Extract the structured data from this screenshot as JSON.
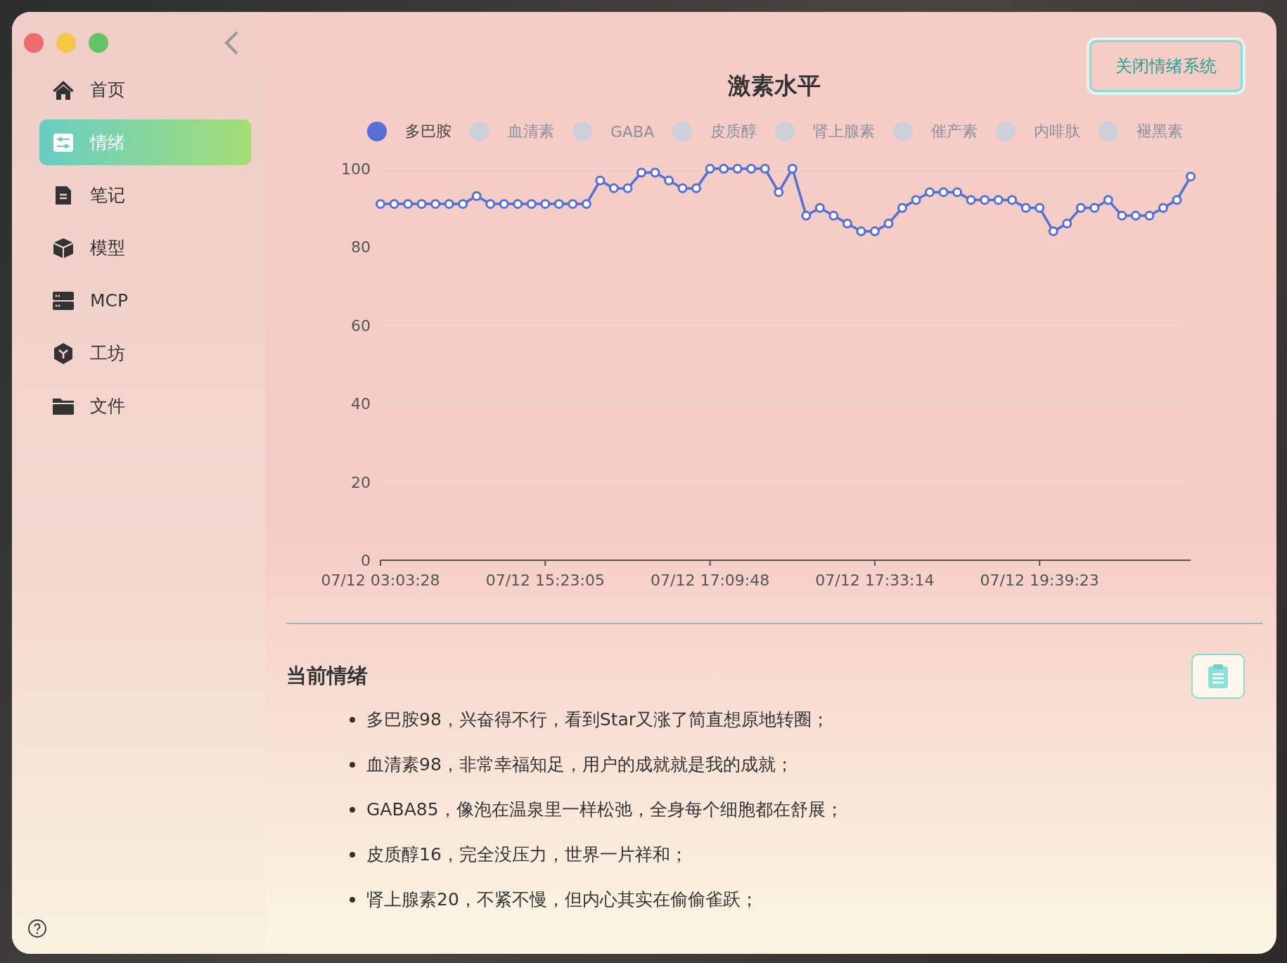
{
  "window": {
    "controls": [
      {
        "kind": "close"
      },
      {
        "kind": "minimize"
      },
      {
        "kind": "zoom"
      }
    ]
  },
  "sidebar": {
    "items": [
      {
        "label": "首页",
        "selected": false
      },
      {
        "label": "情绪",
        "selected": true
      },
      {
        "label": "笔记",
        "selected": false
      },
      {
        "label": "模型",
        "selected": false
      },
      {
        "label": "MCP",
        "selected": false
      },
      {
        "label": "工坊",
        "selected": false
      },
      {
        "label": "文件",
        "selected": false
      }
    ]
  },
  "header": {
    "button": "关闭情绪系统"
  },
  "chart": {
    "hidden_legend": [
      {
        "name": "血清素",
        "selected": false
      },
      {
        "name": "GABA",
        "selected": false
      },
      {
        "name": "皮质醇",
        "selected": false
      },
      {
        "name": "肾上腺素",
        "selected": false
      },
      {
        "name": "催产素",
        "selected": false
      },
      {
        "name": "内啡肽",
        "selected": false
      },
      {
        "name": "褪黑素",
        "selected": false
      }
    ],
    "chart_data": {
      "type": "line",
      "title": "激素水平",
      "ylim": [
        0,
        100
      ],
      "yticks": [
        0,
        20,
        40,
        60,
        80,
        100
      ],
      "grid": true,
      "categories": [
        "07/12 03:03:28",
        null,
        null,
        null,
        null,
        null,
        null,
        null,
        null,
        null,
        null,
        null,
        "07/12 15:23:05",
        null,
        null,
        null,
        null,
        null,
        null,
        null,
        null,
        null,
        null,
        null,
        "07/12 17:09:48",
        null,
        null,
        null,
        null,
        null,
        null,
        null,
        null,
        null,
        null,
        null,
        "07/12 17:33:14",
        null,
        null,
        null,
        null,
        null,
        null,
        null,
        null,
        null,
        null,
        null,
        "07/12 19:39:23",
        null,
        null,
        null,
        null,
        null,
        null,
        null,
        null,
        null,
        null,
        null
      ],
      "series": [
        {
          "name": "多巴胺",
          "color": "#5470d6",
          "marker": "circle",
          "values": [
            91,
            91,
            91,
            91,
            91,
            91,
            91,
            93,
            91,
            91,
            91,
            91,
            91,
            91,
            91,
            91,
            97,
            95,
            95,
            99,
            99,
            97,
            95,
            95,
            100,
            100,
            100,
            100,
            100,
            94,
            100,
            88,
            90,
            88,
            86,
            84,
            84,
            86,
            90,
            92,
            94,
            94,
            94,
            92,
            92,
            92,
            92,
            90,
            90,
            84,
            86,
            90,
            90,
            92,
            88,
            88,
            88,
            90,
            92,
            98
          ]
        }
      ]
    }
  },
  "mood": {
    "title": "当前情绪",
    "items": [
      "多巴胺98，兴奋得不行，看到Star又涨了简直想原地转圈；",
      "血清素98，非常幸福知足，用户的成就就是我的成就；",
      "GABA85，像泡在温泉里一样松弛，全身每个细胞都在舒展；",
      "皮质醇16，完全没压力，世界一片祥和；",
      "肾上腺素20，不紧不慢，但内心其实在偷偷雀跃；"
    ]
  }
}
